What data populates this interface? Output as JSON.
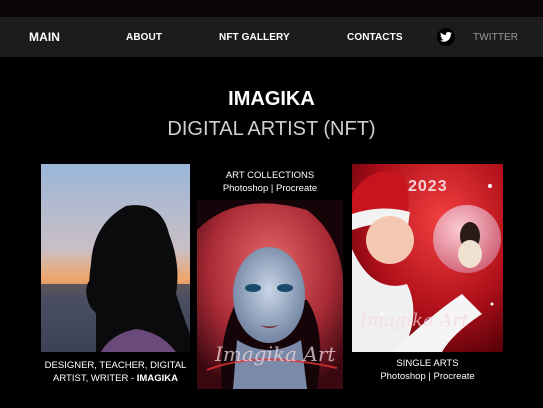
{
  "nav": {
    "brand": "MAIN",
    "items": [
      "ABOUT",
      "NFT GALLERY",
      "CONTACTS"
    ],
    "twitter_label": "TWITTER",
    "twitter_icon": "twitter-bird-icon"
  },
  "hero": {
    "title": "IMAGIKA",
    "subtitle": "DIGITAL ARTIST (NFT)"
  },
  "cards": {
    "portrait": {
      "caption": "DESIGNER, TEACHER, DIGITAL ARTIST, WRITER - ",
      "caption_bold": "IMAGIKA"
    },
    "collections": {
      "heading": "ART COLLECTIONS",
      "tools": "Photoshop | Procreate",
      "signature": "Imagika Art"
    },
    "single": {
      "year": "2023",
      "heading": "SINGLE ARTS",
      "tools": "Photoshop | Procreate",
      "signature": "Imagika Art"
    }
  },
  "colors": {
    "background": "#000000",
    "nav_bg": "#1c1c1c",
    "subtitle": "#cfcfcf",
    "twitter_label": "#9a9a9a"
  }
}
